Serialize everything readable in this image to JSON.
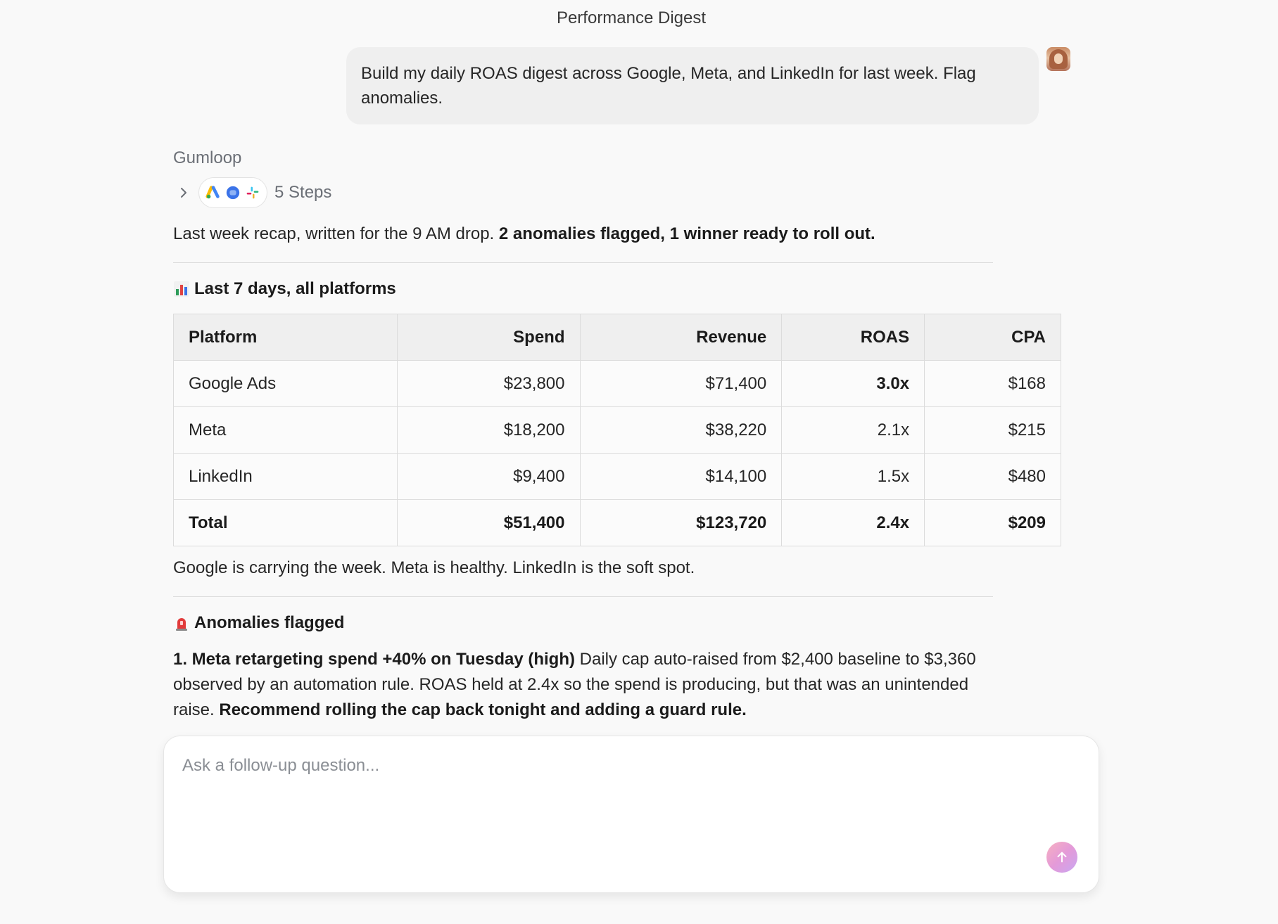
{
  "page": {
    "title": "Performance Digest"
  },
  "user_message": {
    "text": "Build my daily ROAS digest across Google, Meta, and LinkedIn for last week. Flag anomalies."
  },
  "assistant": {
    "name": "Gumloop",
    "steps_label": "5 Steps",
    "step_icons": [
      "google-ads-icon",
      "meta-icon",
      "slack-icon"
    ],
    "intro_text": "Last week recap, written for the 9 AM drop. ",
    "intro_bold": "2 anomalies flagged, 1 winner ready to roll out.",
    "section1": {
      "emoji_icon": "bar-chart-icon",
      "title": "Last 7 days, all platforms"
    },
    "table": {
      "headers": [
        "Platform",
        "Spend",
        "Revenue",
        "ROAS",
        "CPA"
      ],
      "rows": [
        {
          "platform": "Google Ads",
          "spend": "$23,800",
          "revenue": "$71,400",
          "roas": "3.0x",
          "cpa": "$168"
        },
        {
          "platform": "Meta",
          "spend": "$18,200",
          "revenue": "$38,220",
          "roas": "2.1x",
          "cpa": "$215"
        },
        {
          "platform": "LinkedIn",
          "spend": "$9,400",
          "revenue": "$14,100",
          "roas": "1.5x",
          "cpa": "$480"
        }
      ],
      "total": {
        "platform": "Total",
        "spend": "$51,400",
        "revenue": "$123,720",
        "roas": "2.4x",
        "cpa": "$209"
      }
    },
    "summary_text": "Google is carrying the week. Meta is healthy. LinkedIn is the soft spot.",
    "section2": {
      "emoji_icon": "siren-icon",
      "title": "Anomalies flagged"
    },
    "anomaly1": {
      "bold_lead": "1. Meta retargeting spend +40% on Tuesday (high)",
      "body": " Daily cap auto-raised from $2,400 baseline to $3,360 observed by an automation rule. ROAS held at 2.4x so the spend is producing, but that was an unintended raise. ",
      "bold_tail": "Recommend rolling the cap back tonight and adding a guard rule."
    }
  },
  "composer": {
    "placeholder": "Ask a follow-up question...",
    "value": ""
  },
  "colors": {
    "background": "#f9f9f9",
    "bubble": "#efefef",
    "muted_text": "#6b6f76",
    "send_gradient": [
      "#f7b0c0",
      "#e49ad8",
      "#c9a7f2"
    ]
  }
}
